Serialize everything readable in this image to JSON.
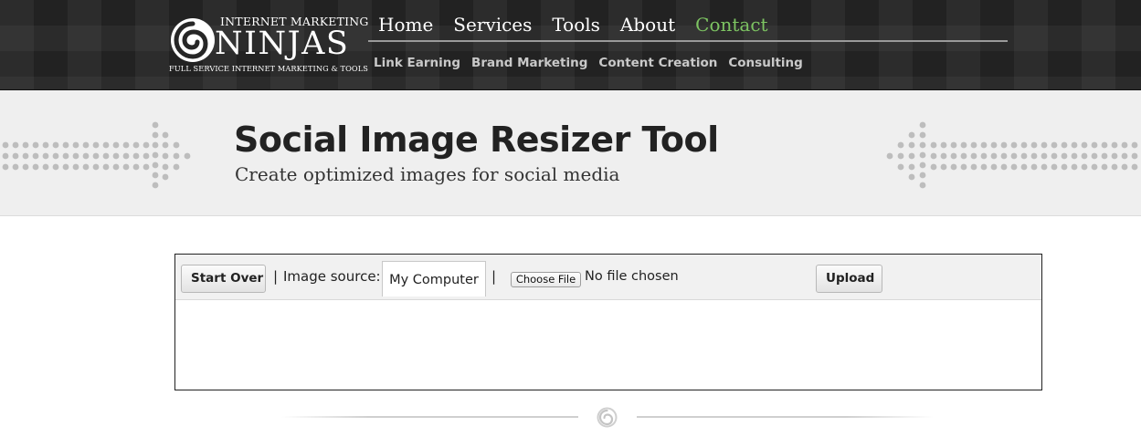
{
  "header": {
    "logo": {
      "top_line": "INTERNET MARKETING",
      "main": "NINJAS",
      "tagline": "FULL SERVICE INTERNET MARKETING & TOOLS"
    },
    "main_nav": [
      {
        "label": "Home",
        "active": false
      },
      {
        "label": "Services",
        "active": false
      },
      {
        "label": "Tools",
        "active": false
      },
      {
        "label": "About",
        "active": false
      },
      {
        "label": "Contact",
        "active": true
      }
    ],
    "sub_nav": [
      {
        "label": "Link Earning"
      },
      {
        "label": "Brand Marketing"
      },
      {
        "label": "Content Creation"
      },
      {
        "label": "Consulting"
      }
    ],
    "colors": {
      "background": "#262626",
      "nav_text": "#ffffff",
      "nav_active": "#7dc462",
      "sub_nav_text": "#c9c9c9"
    }
  },
  "hero": {
    "title": "Social Image Resizer Tool",
    "subtitle": "Create optimized images for social media"
  },
  "toolbar": {
    "start_over_label": "Start Over",
    "separator": "|",
    "image_source_label": "Image source:",
    "source_tab_label": "My Computer",
    "choose_file_label": "Choose File",
    "file_status": "No file chosen",
    "upload_label": "Upload"
  },
  "icons": {
    "logo": "swirl-logo-icon",
    "divider": "swirl-divider-icon",
    "decoration": "dotted-arrow-icon"
  }
}
